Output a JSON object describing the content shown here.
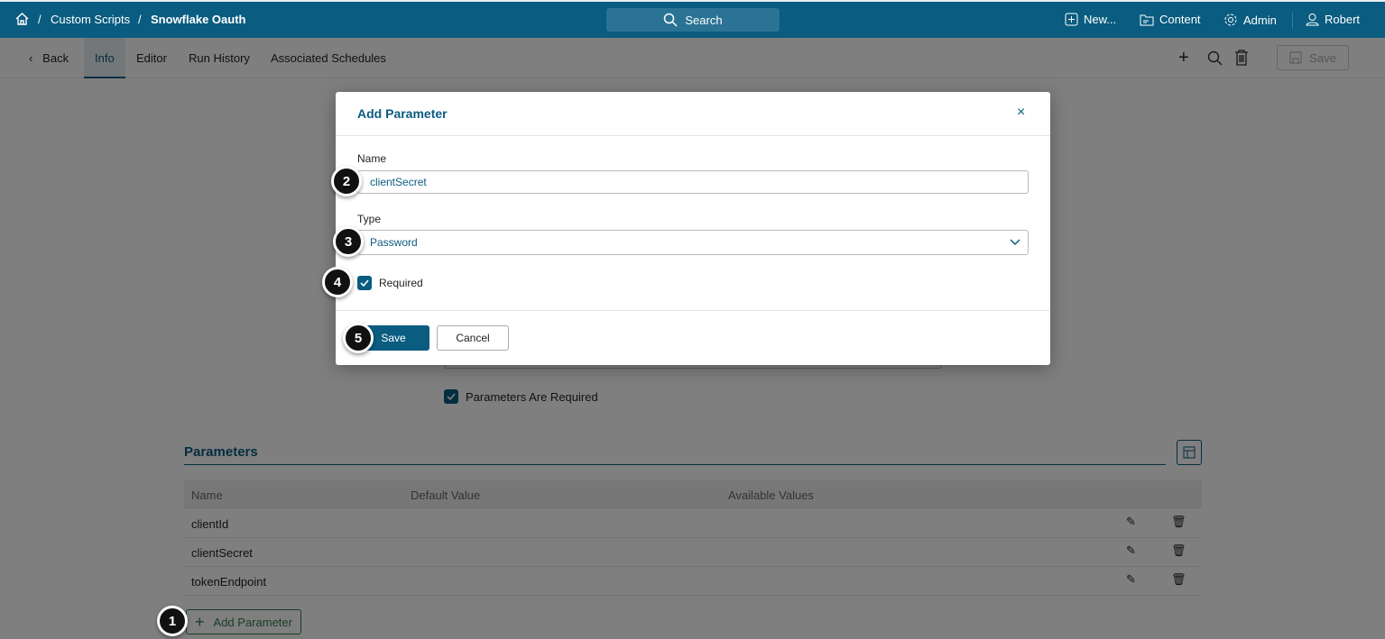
{
  "header": {
    "breadcrumb": [
      "Custom Scripts",
      "Snowflake Oauth"
    ],
    "separator": "/",
    "search": "Search",
    "new": "New...",
    "content": "Content",
    "admin": "Admin",
    "user": "Robert"
  },
  "subnav": {
    "back": "Back",
    "tabs": [
      "Info",
      "Editor",
      "Run History",
      "Associated Schedules"
    ],
    "save": "Save"
  },
  "page": {
    "params_required": "Parameters Are Required",
    "section_title": "Parameters",
    "columns": [
      "Name",
      "Default Value",
      "Available Values"
    ],
    "rows": [
      "clientId",
      "clientSecret",
      "tokenEndpoint"
    ],
    "add_parameter": "Add Parameter"
  },
  "modal": {
    "title": "Add Parameter",
    "name_label": "Name",
    "name_value": "clientSecret",
    "type_label": "Type",
    "type_value": "Password",
    "required_label": "Required",
    "save": "Save",
    "cancel": "Cancel"
  },
  "badges": [
    "1",
    "2",
    "3",
    "4",
    "5"
  ],
  "colors": {
    "brand": "#0a5c80"
  }
}
